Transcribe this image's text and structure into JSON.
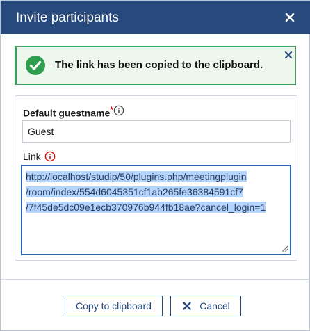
{
  "dialog": {
    "title": "Invite participants",
    "close_icon": "close-icon"
  },
  "alert": {
    "icon": "check-circle-icon",
    "message": "The link has been copied to the clipboard.",
    "close_icon": "close-icon",
    "color": "#3aa05a"
  },
  "form": {
    "guest_label": "Default guestname",
    "guest_required_mark": "*",
    "guest_info_icon": "info-icon",
    "guest_value": "Guest",
    "link_label": "Link",
    "link_warn_icon": "info-warning-icon",
    "link_lines": [
      "http://localhost/studip/50/plugins.php/meetingplugin",
      "/room/index/554d6045351cf1ab265fe36384591cf7",
      "/7f45de5dc09e1ecb370976b944fb18ae?cancel_login=1"
    ]
  },
  "buttons": {
    "copy_label": "Copy to clipboard",
    "cancel_label": "Cancel",
    "cancel_icon": "x-icon"
  },
  "colors": {
    "titlebar": "#28497c",
    "accent": "#2d64b4",
    "required": "#d60000",
    "selection": "#b3d4fc"
  }
}
